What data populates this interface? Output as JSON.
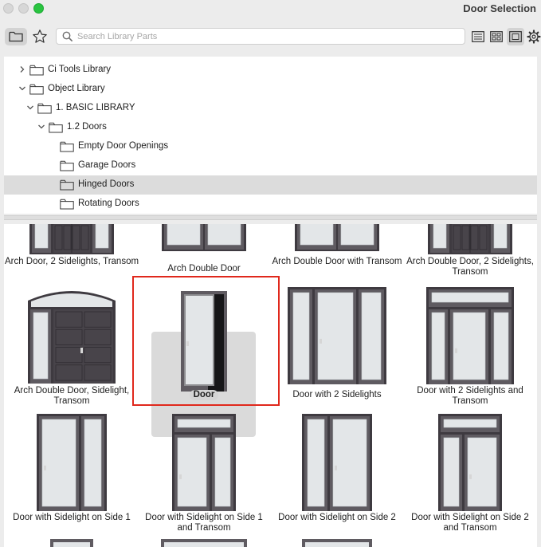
{
  "window": {
    "title": "Door Selection"
  },
  "toolbar": {
    "search_placeholder": "Search Library Parts",
    "folder_icon": "folder-icon",
    "favorites_icon": "star-icon",
    "list_view_icon": "list-view-icon",
    "grid_view_icon": "grid-view-icon",
    "large_view_icon": "large-view-icon",
    "settings_icon": "gear-icon"
  },
  "tree": {
    "items": [
      {
        "label": "Ci Tools Library",
        "level": 0,
        "expanded": false,
        "selected": false
      },
      {
        "label": "Object Library",
        "level": 0,
        "expanded": true,
        "selected": false
      },
      {
        "label": "1. BASIC LIBRARY",
        "level": 1,
        "expanded": true,
        "selected": false
      },
      {
        "label": "1.2 Doors",
        "level": 2,
        "expanded": true,
        "selected": false
      },
      {
        "label": "Empty Door Openings",
        "level": 3,
        "expanded": null,
        "selected": false
      },
      {
        "label": "Garage Doors",
        "level": 3,
        "expanded": null,
        "selected": false
      },
      {
        "label": "Hinged Doors",
        "level": 3,
        "expanded": null,
        "selected": true
      },
      {
        "label": "Rotating Doors",
        "level": 3,
        "expanded": null,
        "selected": false
      }
    ]
  },
  "grid": {
    "items": [
      {
        "label": "Arch Door, 2 Sidelights, Transom",
        "type": "arch-2side-transom-panel",
        "selected": false
      },
      {
        "label": "Arch Double Door",
        "type": "double-glass",
        "selected": false
      },
      {
        "label": "Arch Double Door with Transom",
        "type": "double-glass",
        "selected": false
      },
      {
        "label": "Arch Double Door, 2 Sidelights, Transom",
        "type": "arch-2side-transom-panel",
        "selected": false
      },
      {
        "label": "Arch Double Door, Sidelight, Transom",
        "type": "arch-double-side",
        "selected": false
      },
      {
        "label": "Door",
        "type": "single",
        "selected": true
      },
      {
        "label": "Door with 2 Sidelights",
        "type": "two-sidelights",
        "selected": false
      },
      {
        "label": "Door with 2 Sidelights and Transom",
        "type": "two-sidelights-transom",
        "selected": false
      },
      {
        "label": "Door with Sidelight on Side 1",
        "type": "sidelight-right",
        "selected": false
      },
      {
        "label": "Door with Sidelight on Side 1 and Transom",
        "type": "sidelight-right-transom",
        "selected": false
      },
      {
        "label": "Door with Sidelight on Side 2",
        "type": "sidelight-left",
        "selected": false
      },
      {
        "label": "Door with Sidelight on Side 2 and Transom",
        "type": "sidelight-left-transom",
        "selected": false
      },
      {
        "label": "",
        "type": "partial-single",
        "selected": false
      },
      {
        "label": "",
        "type": "partial-wide",
        "selected": false
      },
      {
        "label": "",
        "type": "partial-mid",
        "selected": false
      }
    ]
  },
  "colors": {
    "frame": "#5f5b61",
    "frame_dark": "#3e3a40",
    "glass": "#e3e6e8",
    "glass_edge": "#c9cdd0",
    "panel": "#48444a",
    "highlight": "#e0281c",
    "traffic_green": "#29c440"
  }
}
